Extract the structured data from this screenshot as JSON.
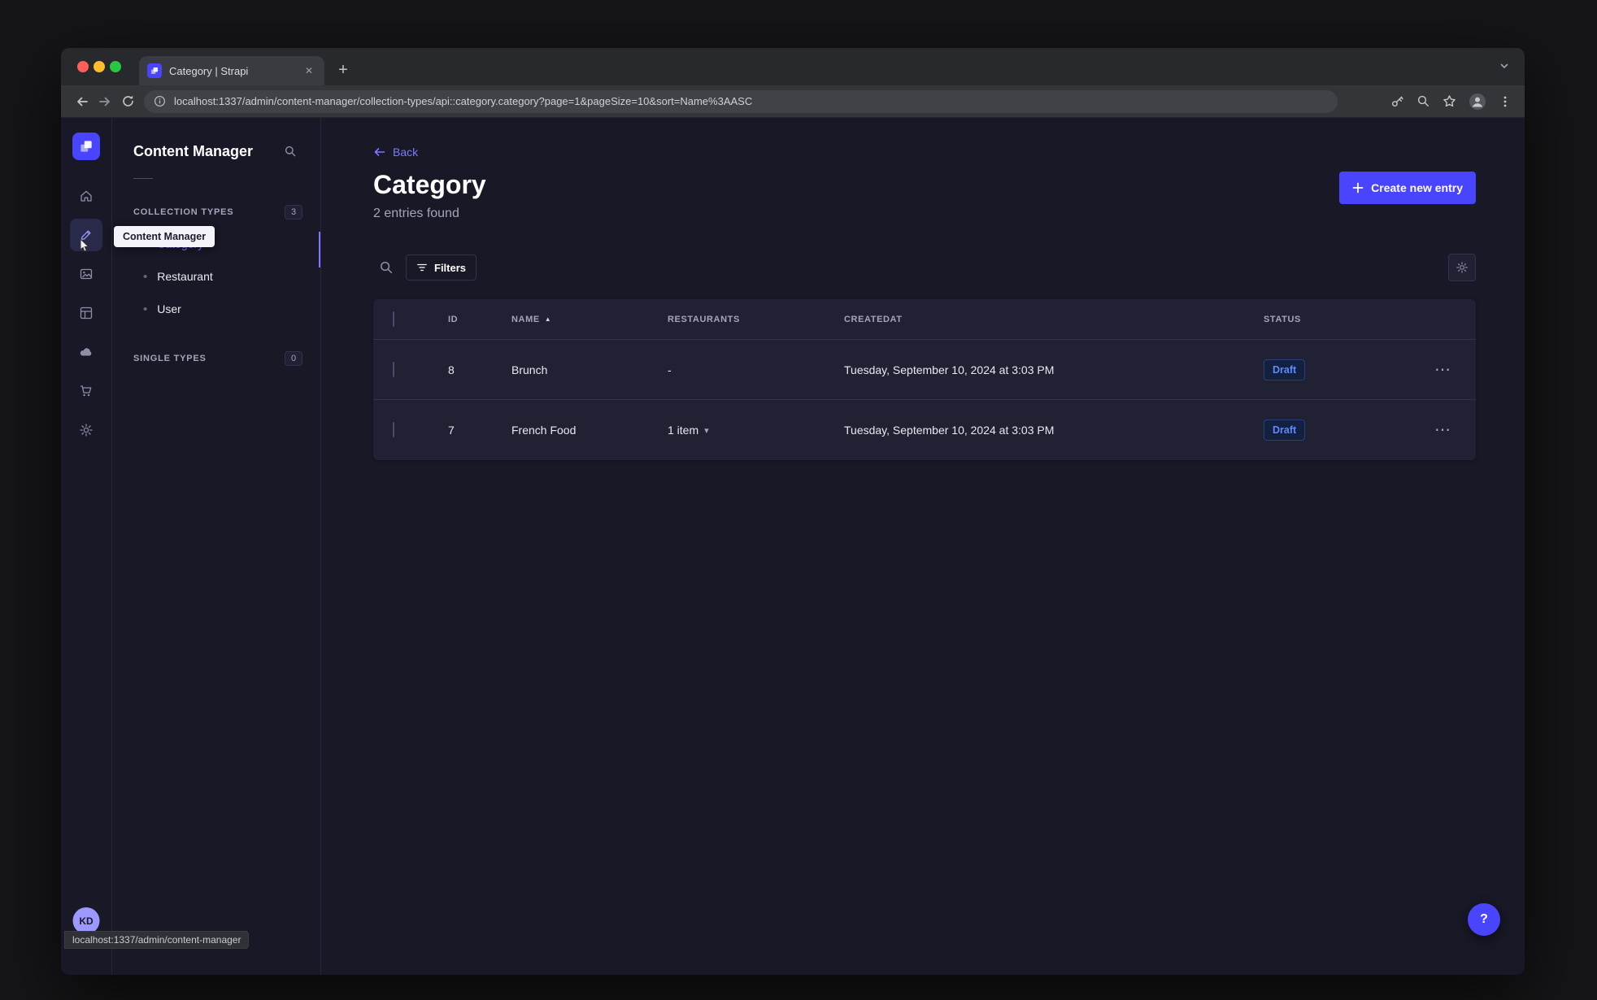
{
  "browser": {
    "tab_title": "Category | Strapi",
    "url": "localhost:1337/admin/content-manager/collection-types/api::category.category?page=1&pageSize=10&sort=Name%3AASC"
  },
  "glyphs": {
    "close": "✕",
    "plus": "+",
    "ellipsis": "⋯",
    "caret_down": "▾",
    "sort_asc": "▲",
    "bullet": "•",
    "question": "?"
  },
  "sidebar": {
    "tooltip": "Content Manager",
    "avatar_initials": "KD"
  },
  "subnav": {
    "title": "Content Manager",
    "sections": [
      {
        "label": "COLLECTION TYPES",
        "badge": "3"
      },
      {
        "label": "SINGLE TYPES",
        "badge": "0"
      }
    ],
    "items": [
      {
        "label": "Category"
      },
      {
        "label": "Restaurant"
      },
      {
        "label": "User"
      }
    ]
  },
  "status_bubble": "localhost:1337/admin/content-manager",
  "page": {
    "back": "Back",
    "title": "Category",
    "subtitle": "2 entries found",
    "create_button": "Create new entry",
    "filters_button": "Filters"
  },
  "table": {
    "headers": {
      "id": "ID",
      "name": "NAME",
      "restaurants": "RESTAURANTS",
      "createdat": "CREATEDAT",
      "status": "STATUS"
    },
    "rows": [
      {
        "id": "8",
        "name": "Brunch",
        "restaurants": "-",
        "createdat": "Tuesday, September 10, 2024 at 3:03 PM",
        "status": "Draft"
      },
      {
        "id": "7",
        "name": "French Food",
        "restaurants": "1 item",
        "createdat": "Tuesday, September 10, 2024 at 3:03 PM",
        "status": "Draft"
      }
    ]
  }
}
